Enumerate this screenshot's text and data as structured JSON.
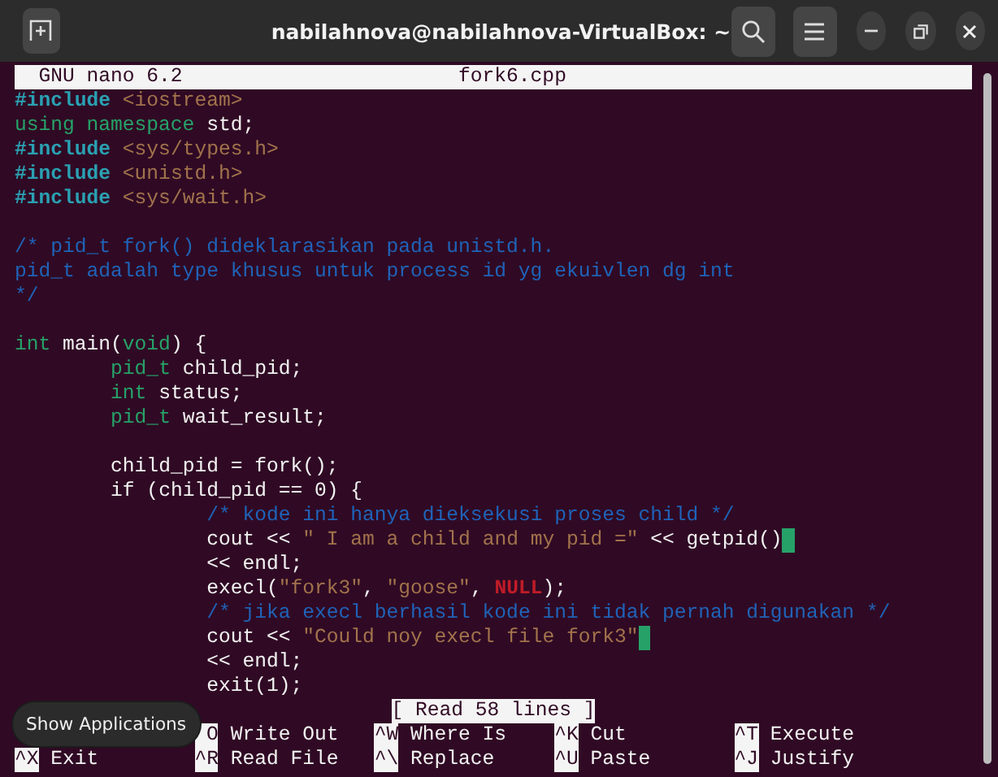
{
  "window": {
    "title": "nabilahnova@nabilahnova-VirtualBox: ~"
  },
  "nano": {
    "version_label": "GNU nano 6.2",
    "filename": "fork6.cpp"
  },
  "code_lines": [
    {
      "kind": "code",
      "segments": [
        {
          "kind": "preproc",
          "text": "#include "
        },
        {
          "kind": "string",
          "text": "<iostream>"
        }
      ],
      "trailing_space": false
    },
    {
      "kind": "code",
      "segments": [
        {
          "kind": "keyword",
          "text": "using namespace "
        },
        {
          "kind": "plain",
          "text": "std;"
        }
      ],
      "trailing_space": false
    },
    {
      "kind": "code",
      "segments": [
        {
          "kind": "preproc",
          "text": "#include "
        },
        {
          "kind": "string",
          "text": "<sys/types.h>"
        }
      ],
      "trailing_space": false
    },
    {
      "kind": "code",
      "segments": [
        {
          "kind": "preproc",
          "text": "#include "
        },
        {
          "kind": "string",
          "text": "<unistd.h>"
        }
      ],
      "trailing_space": false
    },
    {
      "kind": "code",
      "segments": [
        {
          "kind": "preproc",
          "text": "#include "
        },
        {
          "kind": "string",
          "text": "<sys/wait.h>"
        }
      ],
      "trailing_space": false
    },
    {
      "kind": "blank"
    },
    {
      "kind": "code",
      "segments": [
        {
          "kind": "comment",
          "text": "/* pid_t fork() dideklarasikan pada unistd.h."
        }
      ],
      "trailing_space": false
    },
    {
      "kind": "code",
      "segments": [
        {
          "kind": "comment",
          "text": "pid_t adalah type khusus untuk process id yg ekuivlen dg int"
        }
      ],
      "trailing_space": false
    },
    {
      "kind": "code",
      "segments": [
        {
          "kind": "comment",
          "text": "*/"
        }
      ],
      "trailing_space": false
    },
    {
      "kind": "blank"
    },
    {
      "kind": "code",
      "segments": [
        {
          "kind": "keyword",
          "text": "int"
        },
        {
          "kind": "plain",
          "text": " main("
        },
        {
          "kind": "keyword",
          "text": "void"
        },
        {
          "kind": "plain",
          "text": ") {"
        }
      ],
      "trailing_space": false
    },
    {
      "kind": "code",
      "segments": [
        {
          "kind": "keyword",
          "text": "\tpid_t"
        },
        {
          "kind": "plain",
          "text": " child_pid;"
        }
      ],
      "trailing_space": false
    },
    {
      "kind": "code",
      "segments": [
        {
          "kind": "keyword",
          "text": "\tint"
        },
        {
          "kind": "plain",
          "text": " status;"
        }
      ],
      "trailing_space": false
    },
    {
      "kind": "code",
      "segments": [
        {
          "kind": "keyword",
          "text": "\tpid_t"
        },
        {
          "kind": "plain",
          "text": " wait_result;"
        }
      ],
      "trailing_space": false
    },
    {
      "kind": "blank"
    },
    {
      "kind": "code",
      "segments": [
        {
          "kind": "plain",
          "text": "\tchild_pid = fork();"
        }
      ],
      "trailing_space": false
    },
    {
      "kind": "code",
      "segments": [
        {
          "kind": "plain",
          "text": "\tif (child_pid == 0) {"
        }
      ],
      "trailing_space": false
    },
    {
      "kind": "code",
      "segments": [
        {
          "kind": "comment",
          "text": "\t\t/* kode ini hanya dieksekusi proses child */"
        }
      ],
      "trailing_space": false
    },
    {
      "kind": "code",
      "segments": [
        {
          "kind": "plain",
          "text": "\t\tcout << "
        },
        {
          "kind": "string",
          "text": "\" I am a child and my pid =\""
        },
        {
          "kind": "plain",
          "text": " << getpid()"
        }
      ],
      "trailing_space": true
    },
    {
      "kind": "code",
      "segments": [
        {
          "kind": "plain",
          "text": "\t\t<< endl;"
        }
      ],
      "trailing_space": false
    },
    {
      "kind": "code",
      "segments": [
        {
          "kind": "plain",
          "text": "\t\texecl("
        },
        {
          "kind": "string",
          "text": "\"fork3\""
        },
        {
          "kind": "plain",
          "text": ", "
        },
        {
          "kind": "string",
          "text": "\"goose\""
        },
        {
          "kind": "plain",
          "text": ", "
        },
        {
          "kind": "constant",
          "text": "NULL"
        },
        {
          "kind": "plain",
          "text": ");"
        }
      ],
      "trailing_space": false
    },
    {
      "kind": "code",
      "segments": [
        {
          "kind": "comment",
          "text": "\t\t/* jika execl berhasil kode ini tidak pernah digunakan */"
        }
      ],
      "trailing_space": false
    },
    {
      "kind": "code",
      "segments": [
        {
          "kind": "plain",
          "text": "\t\tcout << "
        },
        {
          "kind": "string",
          "text": "\"Could noy execl file fork3\""
        }
      ],
      "trailing_space": true
    },
    {
      "kind": "code",
      "segments": [
        {
          "kind": "plain",
          "text": "\t\t<< endl;"
        }
      ],
      "trailing_space": false
    },
    {
      "kind": "code",
      "segments": [
        {
          "kind": "plain",
          "text": "\t\texit(1);"
        }
      ],
      "trailing_space": false
    }
  ],
  "status_message": "[ Read 58 lines ]",
  "shortcut_columns": [
    {
      "entries": [
        {
          "key": "^X",
          "label": "Exit"
        }
      ]
    },
    {
      "entries": [
        {
          "key": "O",
          "label": "Write Out"
        },
        {
          "key": "^R",
          "label": "Read File"
        }
      ]
    },
    {
      "entries": [
        {
          "key": "^W",
          "label": "Where Is"
        },
        {
          "key": "^\\",
          "label": "Replace"
        }
      ]
    },
    {
      "entries": [
        {
          "key": "^K",
          "label": "Cut"
        },
        {
          "key": "^U",
          "label": "Paste"
        }
      ]
    },
    {
      "entries": [
        {
          "key": "^T",
          "label": "Execute"
        },
        {
          "key": "^J",
          "label": "Justify"
        }
      ]
    }
  ],
  "tooltip": "Show Applications"
}
